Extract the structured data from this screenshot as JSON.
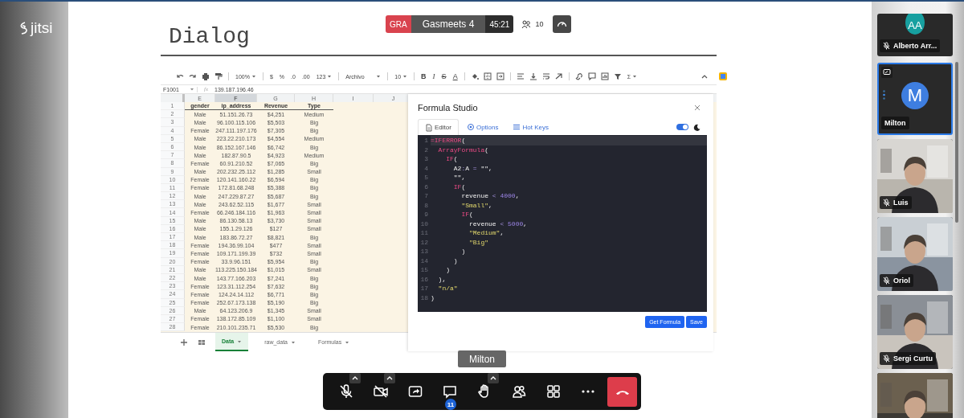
{
  "brand": {
    "logo": "jitsi"
  },
  "conference": {
    "badge": "GRA",
    "name": "Gasmeets 4",
    "timer": "45:21",
    "participant_count": "10"
  },
  "screen": {
    "heading": "Dialog",
    "sheet": {
      "toolbar": [
        {
          "text": "100%",
          "dropdown": true
        },
        {
          "text": "$",
          "dropdown": false
        },
        {
          "text": "%",
          "dropdown": false
        },
        {
          "text": ".0",
          "dropdown": false
        },
        {
          "text": ".00",
          "dropdown": false
        },
        {
          "text": "123",
          "dropdown": true
        },
        {
          "text": "Archivo",
          "dropdown": true
        },
        {
          "text": "10",
          "dropdown": true
        },
        {
          "text": "B",
          "dropdown": false
        },
        {
          "text": "I",
          "dropdown": false
        },
        {
          "text": "S",
          "dropdown": false
        },
        {
          "text": "A",
          "dropdown": false
        },
        {
          "text": "Σ",
          "dropdown": true
        }
      ],
      "formula_bar": {
        "cell_ref": "F1001",
        "fx": "fx",
        "value": "139.187.196.46"
      },
      "columns": [
        {
          "label": "E",
          "selected": false
        },
        {
          "label": "F",
          "selected": true
        },
        {
          "label": "G",
          "selected": false
        },
        {
          "label": "H",
          "selected": false
        },
        {
          "label": "I",
          "selected": false
        },
        {
          "label": "J",
          "selected": false
        }
      ],
      "rows": [
        {
          "number": "1",
          "kind": "header",
          "cells": [
            "gender",
            "ip_address",
            "Revenue",
            "Type"
          ]
        },
        {
          "number": "2",
          "kind": "data",
          "cells": [
            "Male",
            "51.151.26.73",
            "$4,251",
            "Medium"
          ]
        },
        {
          "number": "3",
          "kind": "data",
          "cells": [
            "Male",
            "96.100.115.106",
            "$5,503",
            "Big"
          ]
        },
        {
          "number": "4",
          "kind": "data",
          "cells": [
            "Female",
            "247.111.197.176",
            "$7,305",
            "Big"
          ]
        },
        {
          "number": "5",
          "kind": "data",
          "cells": [
            "Male",
            "223.22.210.173",
            "$4,554",
            "Medium"
          ]
        },
        {
          "number": "6",
          "kind": "data",
          "cells": [
            "Male",
            "86.152.167.146",
            "$6,742",
            "Big"
          ]
        },
        {
          "number": "7",
          "kind": "data",
          "cells": [
            "Male",
            "182.87.90.5",
            "$4,923",
            "Medium"
          ]
        },
        {
          "number": "8",
          "kind": "data",
          "cells": [
            "Female",
            "60.91.210.52",
            "$7,065",
            "Big"
          ]
        },
        {
          "number": "9",
          "kind": "data",
          "cells": [
            "Male",
            "202.232.25.112",
            "$1,285",
            "Small"
          ]
        },
        {
          "number": "10",
          "kind": "data",
          "cells": [
            "Female",
            "120.141.160.22",
            "$6,594",
            "Big"
          ]
        },
        {
          "number": "11",
          "kind": "data",
          "cells": [
            "Female",
            "172.81.68.248",
            "$5,388",
            "Big"
          ]
        },
        {
          "number": "12",
          "kind": "data",
          "cells": [
            "Male",
            "247.229.87.27",
            "$5,687",
            "Big"
          ]
        },
        {
          "number": "13",
          "kind": "data",
          "cells": [
            "Male",
            "243.62.52.115",
            "$1,677",
            "Small"
          ]
        },
        {
          "number": "14",
          "kind": "data",
          "cells": [
            "Female",
            "66.246.184.116",
            "$1,963",
            "Small"
          ]
        },
        {
          "number": "15",
          "kind": "data",
          "cells": [
            "Male",
            "86.130.58.13",
            "$3,730",
            "Small"
          ]
        },
        {
          "number": "16",
          "kind": "data",
          "cells": [
            "Male",
            "155.1.29.126",
            "$127",
            "Small"
          ]
        },
        {
          "number": "17",
          "kind": "data",
          "cells": [
            "Male",
            "183.86.72.27",
            "$8,821",
            "Big"
          ]
        },
        {
          "number": "18",
          "kind": "data",
          "cells": [
            "Female",
            "194.36.99.104",
            "$477",
            "Small"
          ]
        },
        {
          "number": "19",
          "kind": "data",
          "cells": [
            "Female",
            "109.171.199.39",
            "$732",
            "Small"
          ]
        },
        {
          "number": "20",
          "kind": "data",
          "cells": [
            "Female",
            "33.9.96.151",
            "$5,954",
            "Big"
          ]
        },
        {
          "number": "21",
          "kind": "data",
          "cells": [
            "Male",
            "113.225.150.184",
            "$1,015",
            "Small"
          ]
        },
        {
          "number": "22",
          "kind": "data",
          "cells": [
            "Male",
            "143.77.166.203",
            "$7,241",
            "Big"
          ]
        },
        {
          "number": "23",
          "kind": "data",
          "cells": [
            "Female",
            "123.31.112.254",
            "$7,632",
            "Big"
          ]
        },
        {
          "number": "24",
          "kind": "data",
          "cells": [
            "Female",
            "124.24.14.112",
            "$6,771",
            "Big"
          ]
        },
        {
          "number": "25",
          "kind": "data",
          "cells": [
            "Female",
            "252.67.173.138",
            "$5,190",
            "Big"
          ]
        },
        {
          "number": "26",
          "kind": "data",
          "cells": [
            "Male",
            "64.123.206.9",
            "$1,345",
            "Small"
          ]
        },
        {
          "number": "27",
          "kind": "data",
          "cells": [
            "Female",
            "138.172.85.109",
            "$1,100",
            "Small"
          ]
        },
        {
          "number": "28",
          "kind": "data",
          "cells": [
            "Female",
            "210.101.235.71",
            "$5,530",
            "Big"
          ]
        }
      ],
      "sheet_tabs": [
        {
          "label": "Data",
          "selected": true
        },
        {
          "label": "raw_data",
          "selected": false
        },
        {
          "label": "Formulas",
          "selected": false
        }
      ]
    },
    "dialog": {
      "title": "Formula Studio",
      "tabs": [
        {
          "label": "Editor",
          "kind": "editor",
          "selected": true
        },
        {
          "label": "Options",
          "kind": "options",
          "selected": false
        },
        {
          "label": "Hot Keys",
          "kind": "hotkeys",
          "selected": false
        }
      ],
      "dark_mode": true,
      "code": [
        {
          "number": "1",
          "current": true,
          "tokens": [
            {
              "kind": "kw",
              "text": "=IFERROR"
            },
            {
              "kind": "text",
              "text": "("
            }
          ]
        },
        {
          "number": "2",
          "current": false,
          "tokens": [
            {
              "kind": "kw",
              "text": "  ArrayFormula"
            },
            {
              "kind": "text",
              "text": "("
            }
          ]
        },
        {
          "number": "3",
          "current": false,
          "tokens": [
            {
              "kind": "kw",
              "text": "    IF"
            },
            {
              "kind": "text",
              "text": "("
            }
          ]
        },
        {
          "number": "4",
          "current": false,
          "tokens": [
            {
              "kind": "text",
              "text": "      A2"
            },
            {
              "kind": "op",
              "text": ":"
            },
            {
              "kind": "text",
              "text": "A "
            },
            {
              "kind": "op",
              "text": "="
            },
            {
              "kind": "text",
              "text": " \"\","
            }
          ]
        },
        {
          "number": "5",
          "current": false,
          "tokens": [
            {
              "kind": "text",
              "text": "      \"\","
            }
          ]
        },
        {
          "number": "6",
          "current": false,
          "tokens": [
            {
              "kind": "kw",
              "text": "      IF"
            },
            {
              "kind": "text",
              "text": "("
            }
          ]
        },
        {
          "number": "7",
          "current": false,
          "tokens": [
            {
              "kind": "text",
              "text": "        revenue "
            },
            {
              "kind": "op",
              "text": "<"
            },
            {
              "kind": "num",
              "text": " 4000"
            },
            {
              "kind": "text",
              "text": ","
            }
          ]
        },
        {
          "number": "8",
          "current": false,
          "tokens": [
            {
              "kind": "str",
              "text": "        \"Small\""
            },
            {
              "kind": "text",
              "text": ","
            }
          ]
        },
        {
          "number": "9",
          "current": false,
          "tokens": [
            {
              "kind": "kw",
              "text": "        IF"
            },
            {
              "kind": "text",
              "text": "("
            }
          ]
        },
        {
          "number": "10",
          "current": false,
          "tokens": [
            {
              "kind": "text",
              "text": "          revenue "
            },
            {
              "kind": "op",
              "text": "<"
            },
            {
              "kind": "num",
              "text": " 5000"
            },
            {
              "kind": "text",
              "text": ","
            }
          ]
        },
        {
          "number": "11",
          "current": false,
          "tokens": [
            {
              "kind": "str",
              "text": "          \"Medium\""
            },
            {
              "kind": "text",
              "text": ","
            }
          ]
        },
        {
          "number": "12",
          "current": false,
          "tokens": [
            {
              "kind": "str",
              "text": "          \"Big\""
            }
          ]
        },
        {
          "number": "13",
          "current": false,
          "tokens": [
            {
              "kind": "text",
              "text": "        )"
            }
          ]
        },
        {
          "number": "14",
          "current": false,
          "tokens": [
            {
              "kind": "text",
              "text": "      )"
            }
          ]
        },
        {
          "number": "15",
          "current": false,
          "tokens": [
            {
              "kind": "text",
              "text": "    )"
            }
          ]
        },
        {
          "number": "16",
          "current": false,
          "tokens": [
            {
              "kind": "text",
              "text": "  ),"
            }
          ]
        },
        {
          "number": "17",
          "current": false,
          "tokens": [
            {
              "kind": "str",
              "text": "  \"n/a\""
            }
          ]
        },
        {
          "number": "18",
          "current": false,
          "tokens": [
            {
              "kind": "text",
              "text": ")"
            }
          ]
        }
      ],
      "buttons": [
        "Get Formula",
        "Save"
      ]
    }
  },
  "tooltip": "Milton",
  "toolbar": [
    {
      "kind": "mic",
      "on": false,
      "menu": true
    },
    {
      "kind": "camera",
      "on": false,
      "menu": true
    },
    {
      "kind": "screenshare",
      "on": true,
      "menu": false
    },
    {
      "kind": "chat",
      "on": true,
      "menu": false,
      "badge": "11"
    },
    {
      "kind": "hand",
      "on": true,
      "menu": true
    },
    {
      "kind": "participants",
      "on": true,
      "menu": false
    },
    {
      "kind": "tiles",
      "on": true,
      "menu": false
    },
    {
      "kind": "more",
      "menu": false
    },
    {
      "kind": "hangup",
      "menu": false
    }
  ],
  "filmstrip": [
    {
      "kind": "avatar",
      "name": "Alberto Arr...",
      "initials": "AA",
      "color": "#17a0a0",
      "muted": true,
      "selected": false,
      "sharing": false
    },
    {
      "kind": "avatar",
      "name": "Milton",
      "initials": "M",
      "color": "#3e7ee0",
      "muted": false,
      "selected": true,
      "sharing": true
    },
    {
      "kind": "video",
      "name": "Luis",
      "muted": true,
      "selected": false,
      "sharing": false
    },
    {
      "kind": "video",
      "name": "Oriol",
      "muted": true,
      "selected": false,
      "sharing": false
    },
    {
      "kind": "video",
      "name": "Sergi Curtu",
      "muted": true,
      "selected": false,
      "sharing": false
    },
    {
      "kind": "video",
      "selected": false,
      "sharing": false
    }
  ]
}
